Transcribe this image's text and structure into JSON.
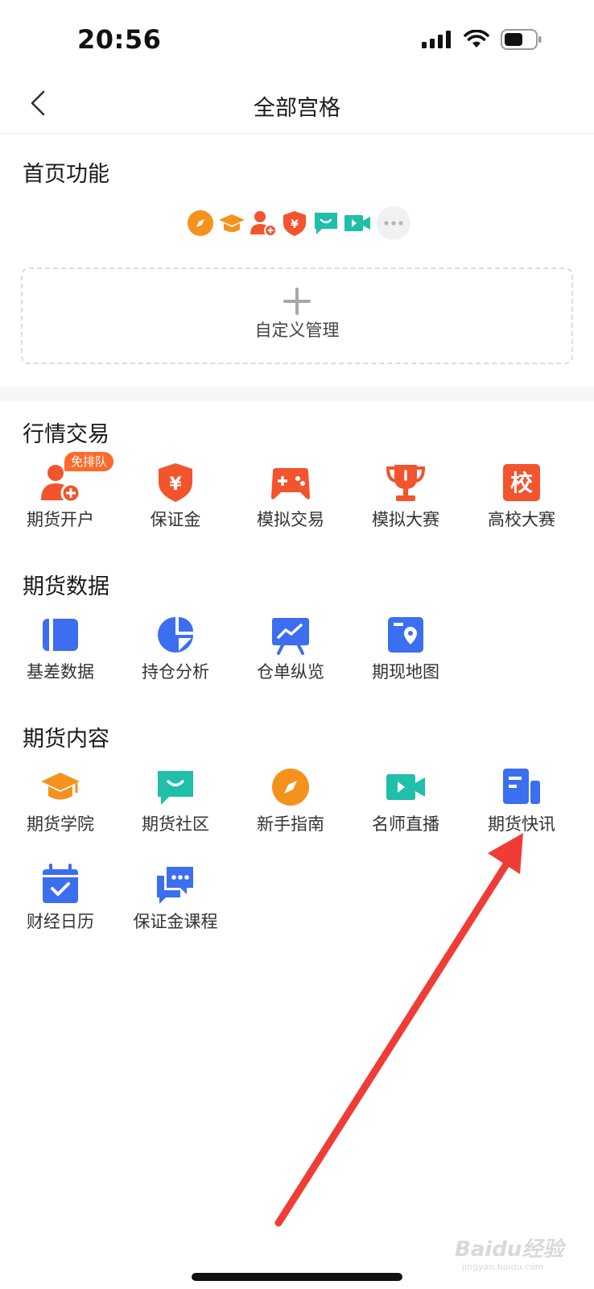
{
  "status_bar": {
    "time": "20:56",
    "icons": [
      "signal-icon",
      "wifi-icon",
      "battery-icon"
    ]
  },
  "nav": {
    "title": "全部宫格",
    "back_icon": "chevron-left-icon"
  },
  "home_functions": {
    "title": "首页功能",
    "pinned_icons": [
      "compass-icon",
      "graduation-cap-icon",
      "user-add-icon",
      "yuan-shield-icon",
      "chat-bubble-icon",
      "video-camera-icon",
      "more-icon"
    ],
    "custom_label": "自定义管理"
  },
  "sections": [
    {
      "title": "行情交易",
      "items": [
        {
          "label": "期货开户",
          "icon": "user-add-icon",
          "color": "#f2542d",
          "badge": "免排队"
        },
        {
          "label": "保证金",
          "icon": "yuan-shield-icon",
          "color": "#f2542d"
        },
        {
          "label": "模拟交易",
          "icon": "gamepad-icon",
          "color": "#f2542d"
        },
        {
          "label": "模拟大赛",
          "icon": "trophy-icon",
          "color": "#f2542d"
        },
        {
          "label": "高校大赛",
          "icon": "school-icon",
          "color": "#f2542d",
          "glyph": "校"
        }
      ]
    },
    {
      "title": "期货数据",
      "items": [
        {
          "label": "基差数据",
          "icon": "notebook-icon",
          "color": "#3c6ef0"
        },
        {
          "label": "持仓分析",
          "icon": "pie-chart-icon",
          "color": "#3c6ef0"
        },
        {
          "label": "仓单纵览",
          "icon": "presentation-chart-icon",
          "color": "#3c6ef0"
        },
        {
          "label": "期现地图",
          "icon": "map-pin-icon",
          "color": "#3c6ef0"
        }
      ]
    },
    {
      "title": "期货内容",
      "items": [
        {
          "label": "期货学院",
          "icon": "graduation-cap-icon",
          "color": "#f5921e"
        },
        {
          "label": "期货社区",
          "icon": "chat-bubble-icon",
          "color": "#1fbfa9"
        },
        {
          "label": "新手指南",
          "icon": "compass-icon",
          "color": "#f5921e"
        },
        {
          "label": "名师直播",
          "icon": "video-camera-icon",
          "color": "#1fbfa9"
        },
        {
          "label": "期货快讯",
          "icon": "newspaper-icon",
          "color": "#3c6ef0"
        },
        {
          "label": "财经日历",
          "icon": "calendar-check-icon",
          "color": "#3c6ef0"
        },
        {
          "label": "保证金课程",
          "icon": "chat-messages-icon",
          "color": "#3c6ef0"
        }
      ]
    }
  ],
  "annotation": {
    "arrow_color": "#f03c35"
  },
  "watermark": {
    "text": "Baidu经验",
    "sub": "jingyan.baidu.com"
  }
}
